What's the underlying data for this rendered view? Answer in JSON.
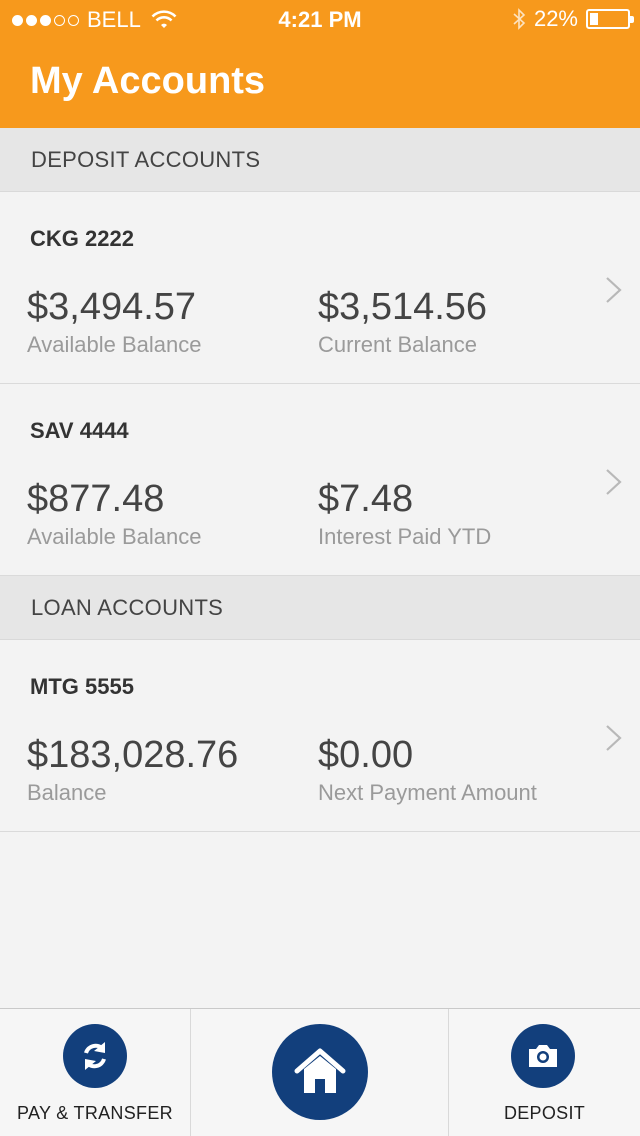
{
  "status_bar": {
    "carrier": "BELL",
    "time": "4:21 PM",
    "battery_percent": "22%",
    "battery_level": 0.22,
    "signal_bars_filled": 3,
    "signal_bars_total": 5
  },
  "header": {
    "title": "My Accounts",
    "background_color": "#f7991c"
  },
  "sections": [
    {
      "header": "DEPOSIT ACCOUNTS",
      "accounts": [
        {
          "name": "CKG 2222",
          "amount1": "$3,494.57",
          "label1": "Available Balance",
          "amount2": "$3,514.56",
          "label2": "Current Balance"
        },
        {
          "name": "SAV 4444",
          "amount1": "$877.48",
          "label1": "Available Balance",
          "amount2": "$7.48",
          "label2": "Interest Paid YTD"
        }
      ]
    },
    {
      "header": "LOAN ACCOUNTS",
      "accounts": [
        {
          "name": "MTG 5555",
          "amount1": "$183,028.76",
          "label1": "Balance",
          "amount2": "$0.00",
          "label2": "Next Payment Amount"
        }
      ]
    }
  ],
  "tab_bar": {
    "pay_transfer_label": "PAY & TRANSFER",
    "pay_transfer_icon": "refresh-icon",
    "home_icon": "home-icon",
    "deposit_label": "DEPOSIT",
    "deposit_icon": "camera-icon",
    "accent_color": "#123f7c"
  }
}
